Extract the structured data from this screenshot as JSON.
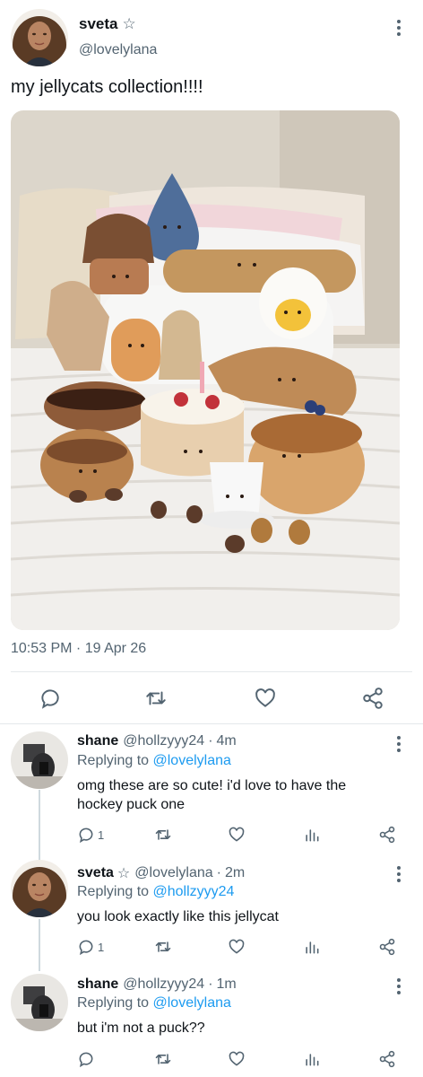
{
  "main_tweet": {
    "author_name": "sveta",
    "verified_star": "☆",
    "handle": "@lovelylana",
    "text": "my jellycats collection!!!!",
    "timestamp": "10:53 PM · 19 Apr 26",
    "photo_icon": "plush-toys-photo",
    "actions": [
      "reply-icon",
      "retweet-icon",
      "like-icon",
      "share-icon"
    ]
  },
  "replies": [
    {
      "author_name": "shane",
      "handle": "@hollzyyy24",
      "dot": "·",
      "time": "4m",
      "replying_prefix": "Replying to",
      "replying_to": "@lovelylana",
      "text": "omg these are so cute! i'd love to have the hockey puck one",
      "reply_count": "1"
    },
    {
      "author_name": "sveta",
      "star": "☆",
      "handle": "@lovelylana",
      "dot": "·",
      "time": "2m",
      "replying_prefix": "Replying to",
      "replying_to": "@hollzyyy24",
      "text": "you look exactly like this jellycat",
      "reply_count": "1"
    },
    {
      "author_name": "shane",
      "handle": "@hollzyyy24",
      "dot": "·",
      "time": "1m",
      "replying_prefix": "Replying to",
      "replying_to": "@lovelylana",
      "text": "but i'm not a puck??",
      "reply_count": ""
    }
  ],
  "colors": {
    "text": "#0f1419",
    "secondary": "#536471",
    "link": "#1d9bf0",
    "divider": "#e4e8eb"
  }
}
